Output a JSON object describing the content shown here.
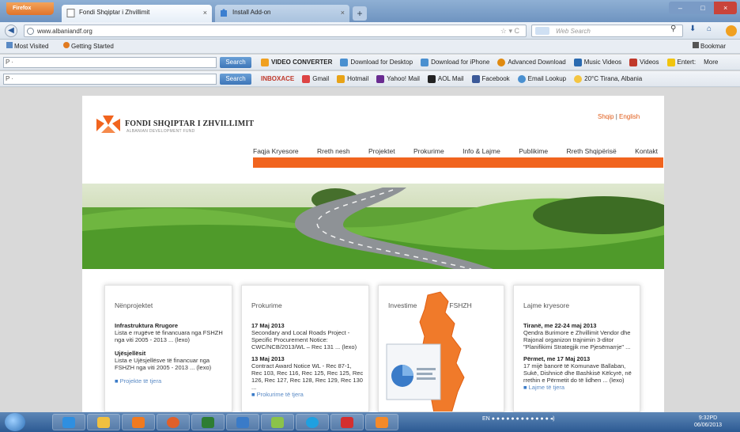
{
  "browser": {
    "menu_button": "Firefox",
    "tabs": [
      {
        "label": "Fondi Shqiptar i Zhvillimit"
      },
      {
        "label": "Install Add-on"
      }
    ],
    "url": "www.albaniandf.org",
    "search_placeholder": "Web Search"
  },
  "bookmarks": {
    "most_visited": "Most Visited",
    "getting_started": "Getting Started",
    "bookmarks_label": "Bookmar"
  },
  "toolbar1": {
    "search_prefix": "P ·",
    "search_button": "Search",
    "items": [
      "VIDEO CONVERTER",
      "Download for Desktop",
      "Download for iPhone",
      "Advanced Download",
      "Music Videos",
      "Videos",
      "Entert:",
      "More"
    ]
  },
  "toolbar2": {
    "search_prefix": "P ·",
    "search_button": "Search",
    "items": [
      "INBOXACE",
      "Gmail",
      "Hotmail",
      "Yahoo! Mail",
      "AOL Mail",
      "Facebook",
      "Email Lookup",
      "20°C Tirana, Albania"
    ]
  },
  "site": {
    "logo_title": "FONDI SHQIPTAR I ZHVILLIMIT",
    "logo_subtitle": "ALBANIAN DEVELOPMENT FUND",
    "lang_shqip": "Shqip",
    "lang_sep": " | ",
    "lang_english": "English",
    "nav": [
      "Faqja Kryesore",
      "Rreth nesh",
      "Projektet",
      "Prokurime",
      "Info & Lajme",
      "Publikime",
      "Rreth Shqipërisë",
      "Kontakt"
    ],
    "boxes": {
      "nenprojektet": {
        "title": "Nënprojektet",
        "item1_title": "Infrastruktura Rrugore",
        "item1_text": "Lista e rrugëve të financuara nga FSHZH nga viti 2005 - 2013 ... (lexo)",
        "item2_title": "Ujësjellësit",
        "item2_text": "Lista e Ujësjellësve të financuar nga FSHZH nga viti 2005 - 2013 ... (lexo)",
        "more": "Projekte të tjera"
      },
      "prokurime": {
        "title": "Prokurime",
        "item1_date": "17 Maj 2013",
        "item1_text": "Secondary and Local Roads Project - Specific Procurement Notice: CWC/NCB/2013/WL – Rec 131 ... (lexo)",
        "item2_date": "13 Maj 2013",
        "item2_text": "Contract Award Notice WL - Rec 87-1, Rec 103, Rec 116, Rec 125, Rec 125, Rec 126, Rec 127, Rec 128, Rec 129, Rec 130 ...",
        "more": "Prokurime të tjera"
      },
      "investime": {
        "title_left": "Investime",
        "title_right": "Atlasi i FSHZH"
      },
      "lajme": {
        "title": "Lajme kryesore",
        "item1_title": "Tiranë, me 22-24 maj 2013",
        "item1_text": "Qendra Burimore e Zhvillimit Vendor dhe Rajonal organizon trajnimin 3-ditor \"Planifikimi Strategjik me Pjesëmarrje\" ...",
        "item2_title": "Përmet, me 17 Maj 2013",
        "item2_text": "17 mijë banorë të Komunave Ballaban, Sukë, Dishnicë dhe Bashkisë Këlcyrë, në rrethin e Përmetit do të lidhen ... (lexo)",
        "more": "Lajme të tjera"
      }
    }
  },
  "taskbar": {
    "lang": "EN",
    "time": "9:32PD",
    "date": "06/06/2013"
  },
  "colors": {
    "accent": "#f1641e",
    "link_blue": "#3a7bc8"
  }
}
